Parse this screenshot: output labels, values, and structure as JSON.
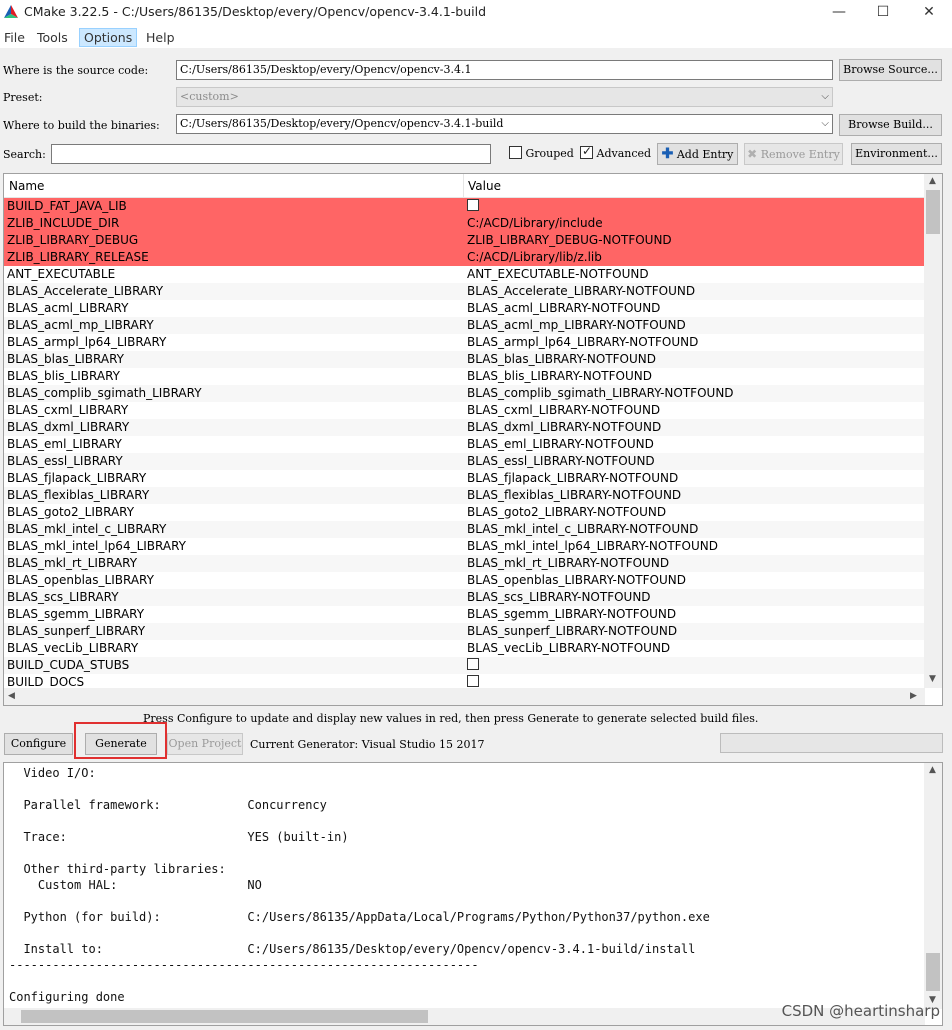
{
  "window": {
    "title": "CMake 3.22.5 - C:/Users/86135/Desktop/every/Opencv/opencv-3.4.1-build",
    "minimize": "—",
    "maximize": "☐",
    "close": "✕"
  },
  "menu": {
    "items": [
      "File",
      "Tools",
      "Options",
      "Help"
    ],
    "active_index": 2
  },
  "source": {
    "label": "Where is the source code:",
    "value": "C:/Users/86135/Desktop/every/Opencv/opencv-3.4.1",
    "browse": "Browse Source..."
  },
  "preset": {
    "label": "Preset:",
    "value": "<custom>"
  },
  "binaries": {
    "label": "Where to build the binaries:",
    "value": "C:/Users/86135/Desktop/every/Opencv/opencv-3.4.1-build",
    "browse": "Browse Build..."
  },
  "search": {
    "label": "Search:",
    "value": ""
  },
  "options": {
    "grouped": "Grouped",
    "grouped_checked": false,
    "advanced": "Advanced",
    "advanced_checked": true
  },
  "toolbar": {
    "add_entry": "Add Entry",
    "remove_entry": "Remove Entry",
    "environment": "Environment..."
  },
  "table": {
    "headers": {
      "name": "Name",
      "value": "Value"
    },
    "rows": [
      {
        "name": "BUILD_FAT_JAVA_LIB",
        "value": "",
        "checkbox": true,
        "new": true
      },
      {
        "name": "ZLIB_INCLUDE_DIR",
        "value": "C:/ACD/Library/include",
        "new": true
      },
      {
        "name": "ZLIB_LIBRARY_DEBUG",
        "value": "ZLIB_LIBRARY_DEBUG-NOTFOUND",
        "new": true
      },
      {
        "name": "ZLIB_LIBRARY_RELEASE",
        "value": "C:/ACD/Library/lib/z.lib",
        "new": true
      },
      {
        "name": "ANT_EXECUTABLE",
        "value": "ANT_EXECUTABLE-NOTFOUND"
      },
      {
        "name": "BLAS_Accelerate_LIBRARY",
        "value": "BLAS_Accelerate_LIBRARY-NOTFOUND"
      },
      {
        "name": "BLAS_acml_LIBRARY",
        "value": "BLAS_acml_LIBRARY-NOTFOUND"
      },
      {
        "name": "BLAS_acml_mp_LIBRARY",
        "value": "BLAS_acml_mp_LIBRARY-NOTFOUND"
      },
      {
        "name": "BLAS_armpl_lp64_LIBRARY",
        "value": "BLAS_armpl_lp64_LIBRARY-NOTFOUND"
      },
      {
        "name": "BLAS_blas_LIBRARY",
        "value": "BLAS_blas_LIBRARY-NOTFOUND"
      },
      {
        "name": "BLAS_blis_LIBRARY",
        "value": "BLAS_blis_LIBRARY-NOTFOUND"
      },
      {
        "name": "BLAS_complib_sgimath_LIBRARY",
        "value": "BLAS_complib_sgimath_LIBRARY-NOTFOUND"
      },
      {
        "name": "BLAS_cxml_LIBRARY",
        "value": "BLAS_cxml_LIBRARY-NOTFOUND"
      },
      {
        "name": "BLAS_dxml_LIBRARY",
        "value": "BLAS_dxml_LIBRARY-NOTFOUND"
      },
      {
        "name": "BLAS_eml_LIBRARY",
        "value": "BLAS_eml_LIBRARY-NOTFOUND"
      },
      {
        "name": "BLAS_essl_LIBRARY",
        "value": "BLAS_essl_LIBRARY-NOTFOUND"
      },
      {
        "name": "BLAS_fjlapack_LIBRARY",
        "value": "BLAS_fjlapack_LIBRARY-NOTFOUND"
      },
      {
        "name": "BLAS_flexiblas_LIBRARY",
        "value": "BLAS_flexiblas_LIBRARY-NOTFOUND"
      },
      {
        "name": "BLAS_goto2_LIBRARY",
        "value": "BLAS_goto2_LIBRARY-NOTFOUND"
      },
      {
        "name": "BLAS_mkl_intel_c_LIBRARY",
        "value": "BLAS_mkl_intel_c_LIBRARY-NOTFOUND"
      },
      {
        "name": "BLAS_mkl_intel_lp64_LIBRARY",
        "value": "BLAS_mkl_intel_lp64_LIBRARY-NOTFOUND"
      },
      {
        "name": "BLAS_mkl_rt_LIBRARY",
        "value": "BLAS_mkl_rt_LIBRARY-NOTFOUND"
      },
      {
        "name": "BLAS_openblas_LIBRARY",
        "value": "BLAS_openblas_LIBRARY-NOTFOUND"
      },
      {
        "name": "BLAS_scs_LIBRARY",
        "value": "BLAS_scs_LIBRARY-NOTFOUND"
      },
      {
        "name": "BLAS_sgemm_LIBRARY",
        "value": "BLAS_sgemm_LIBRARY-NOTFOUND"
      },
      {
        "name": "BLAS_sunperf_LIBRARY",
        "value": "BLAS_sunperf_LIBRARY-NOTFOUND"
      },
      {
        "name": "BLAS_vecLib_LIBRARY",
        "value": "BLAS_vecLib_LIBRARY-NOTFOUND"
      },
      {
        "name": "BUILD_CUDA_STUBS",
        "value": "",
        "checkbox": true
      },
      {
        "name": "BUILD_DOCS",
        "value": "",
        "checkbox": true
      }
    ]
  },
  "hint": "Press Configure to update and display new values in red, then press Generate to generate selected build files.",
  "actions": {
    "configure": "Configure",
    "generate": "Generate",
    "open_project": "Open Project",
    "current_generator": "Current Generator: Visual Studio 15 2017"
  },
  "output": {
    "lines": [
      "  Video I/O:",
      "",
      "  Parallel framework:            Concurrency",
      "",
      "  Trace:                         YES (built-in)",
      "",
      "  Other third-party libraries:",
      "    Custom HAL:                  NO",
      "",
      "  Python (for build):            C:/Users/86135/AppData/Local/Programs/Python/Python37/python.exe",
      "",
      "  Install to:                    C:/Users/86135/Desktop/every/Opencv/opencv-3.4.1-build/install",
      "-----------------------------------------------------------------",
      "",
      "Configuring done"
    ]
  },
  "watermark": "CSDN @heartinsharp",
  "colors": {
    "new_entry_bg": "#ff6565",
    "highlight_border": "#e03030"
  }
}
